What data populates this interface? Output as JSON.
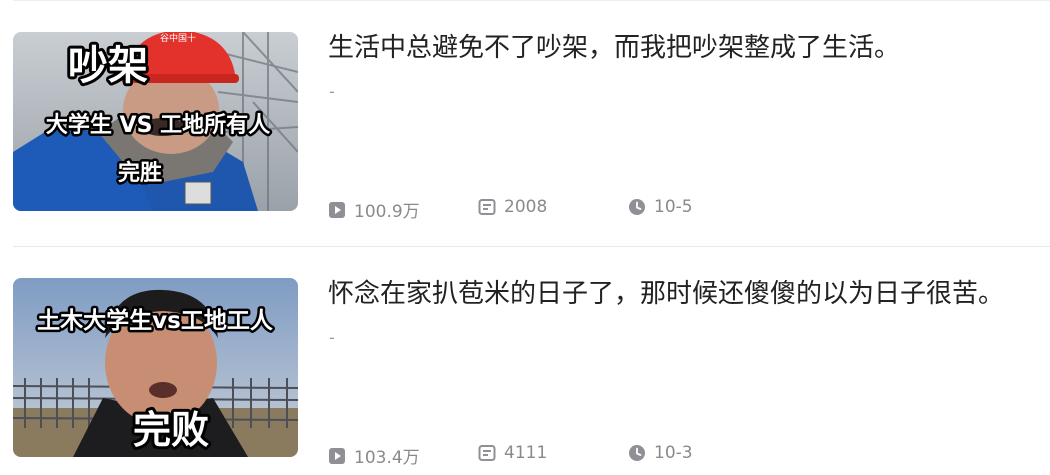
{
  "videos": [
    {
      "title": "生活中总避免不了吵架，而我把吵架整成了生活。",
      "description": "-",
      "views": "100.9万",
      "comments": "2008",
      "date": "10-5",
      "thumbnail_text": {
        "line1": "吵架",
        "line2": "大学生  VS  工地所有人",
        "line3": "完胜",
        "helmet": "谷中国十"
      },
      "icons": {
        "views": "play-count-icon",
        "comments": "comment-icon",
        "date": "clock-icon"
      }
    },
    {
      "title": "怀念在家扒苞米的日子了，那时候还傻傻的以为日子很苦。",
      "description": "-",
      "views": "103.4万",
      "comments": "4111",
      "date": "10-3",
      "thumbnail_text": {
        "line1": "土木大学生vs工地工人",
        "line2": "完败"
      },
      "icons": {
        "views": "play-count-icon",
        "comments": "comment-icon",
        "date": "clock-icon"
      }
    }
  ],
  "colors": {
    "title": "#222222",
    "meta": "#8a8a8a",
    "icon": "#8e9095",
    "divider": "#e9e9e9"
  }
}
